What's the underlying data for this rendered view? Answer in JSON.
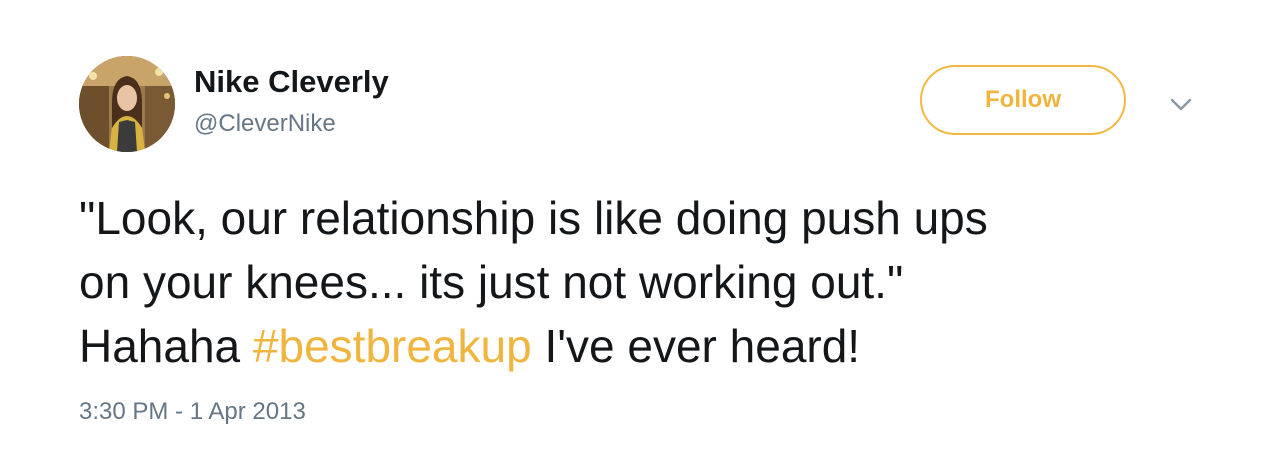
{
  "user": {
    "display_name": "Nike Cleverly",
    "handle": "@CleverNike"
  },
  "follow_button": {
    "label": "Follow"
  },
  "tweet": {
    "line1": "\"Look, our relationship is like doing push ups",
    "line2": "on your knees... its just not working out.\"",
    "line3_prefix": "Hahaha ",
    "hashtag": "#bestbreakup",
    "line3_suffix": " I've ever heard!"
  },
  "timestamp": "3:30 PM - 1 Apr 2013",
  "icons": {
    "menu": "chevron-down-icon"
  },
  "colors": {
    "accent": "#f0b53e",
    "name": "#14171a",
    "secondary_text": "#657786"
  }
}
